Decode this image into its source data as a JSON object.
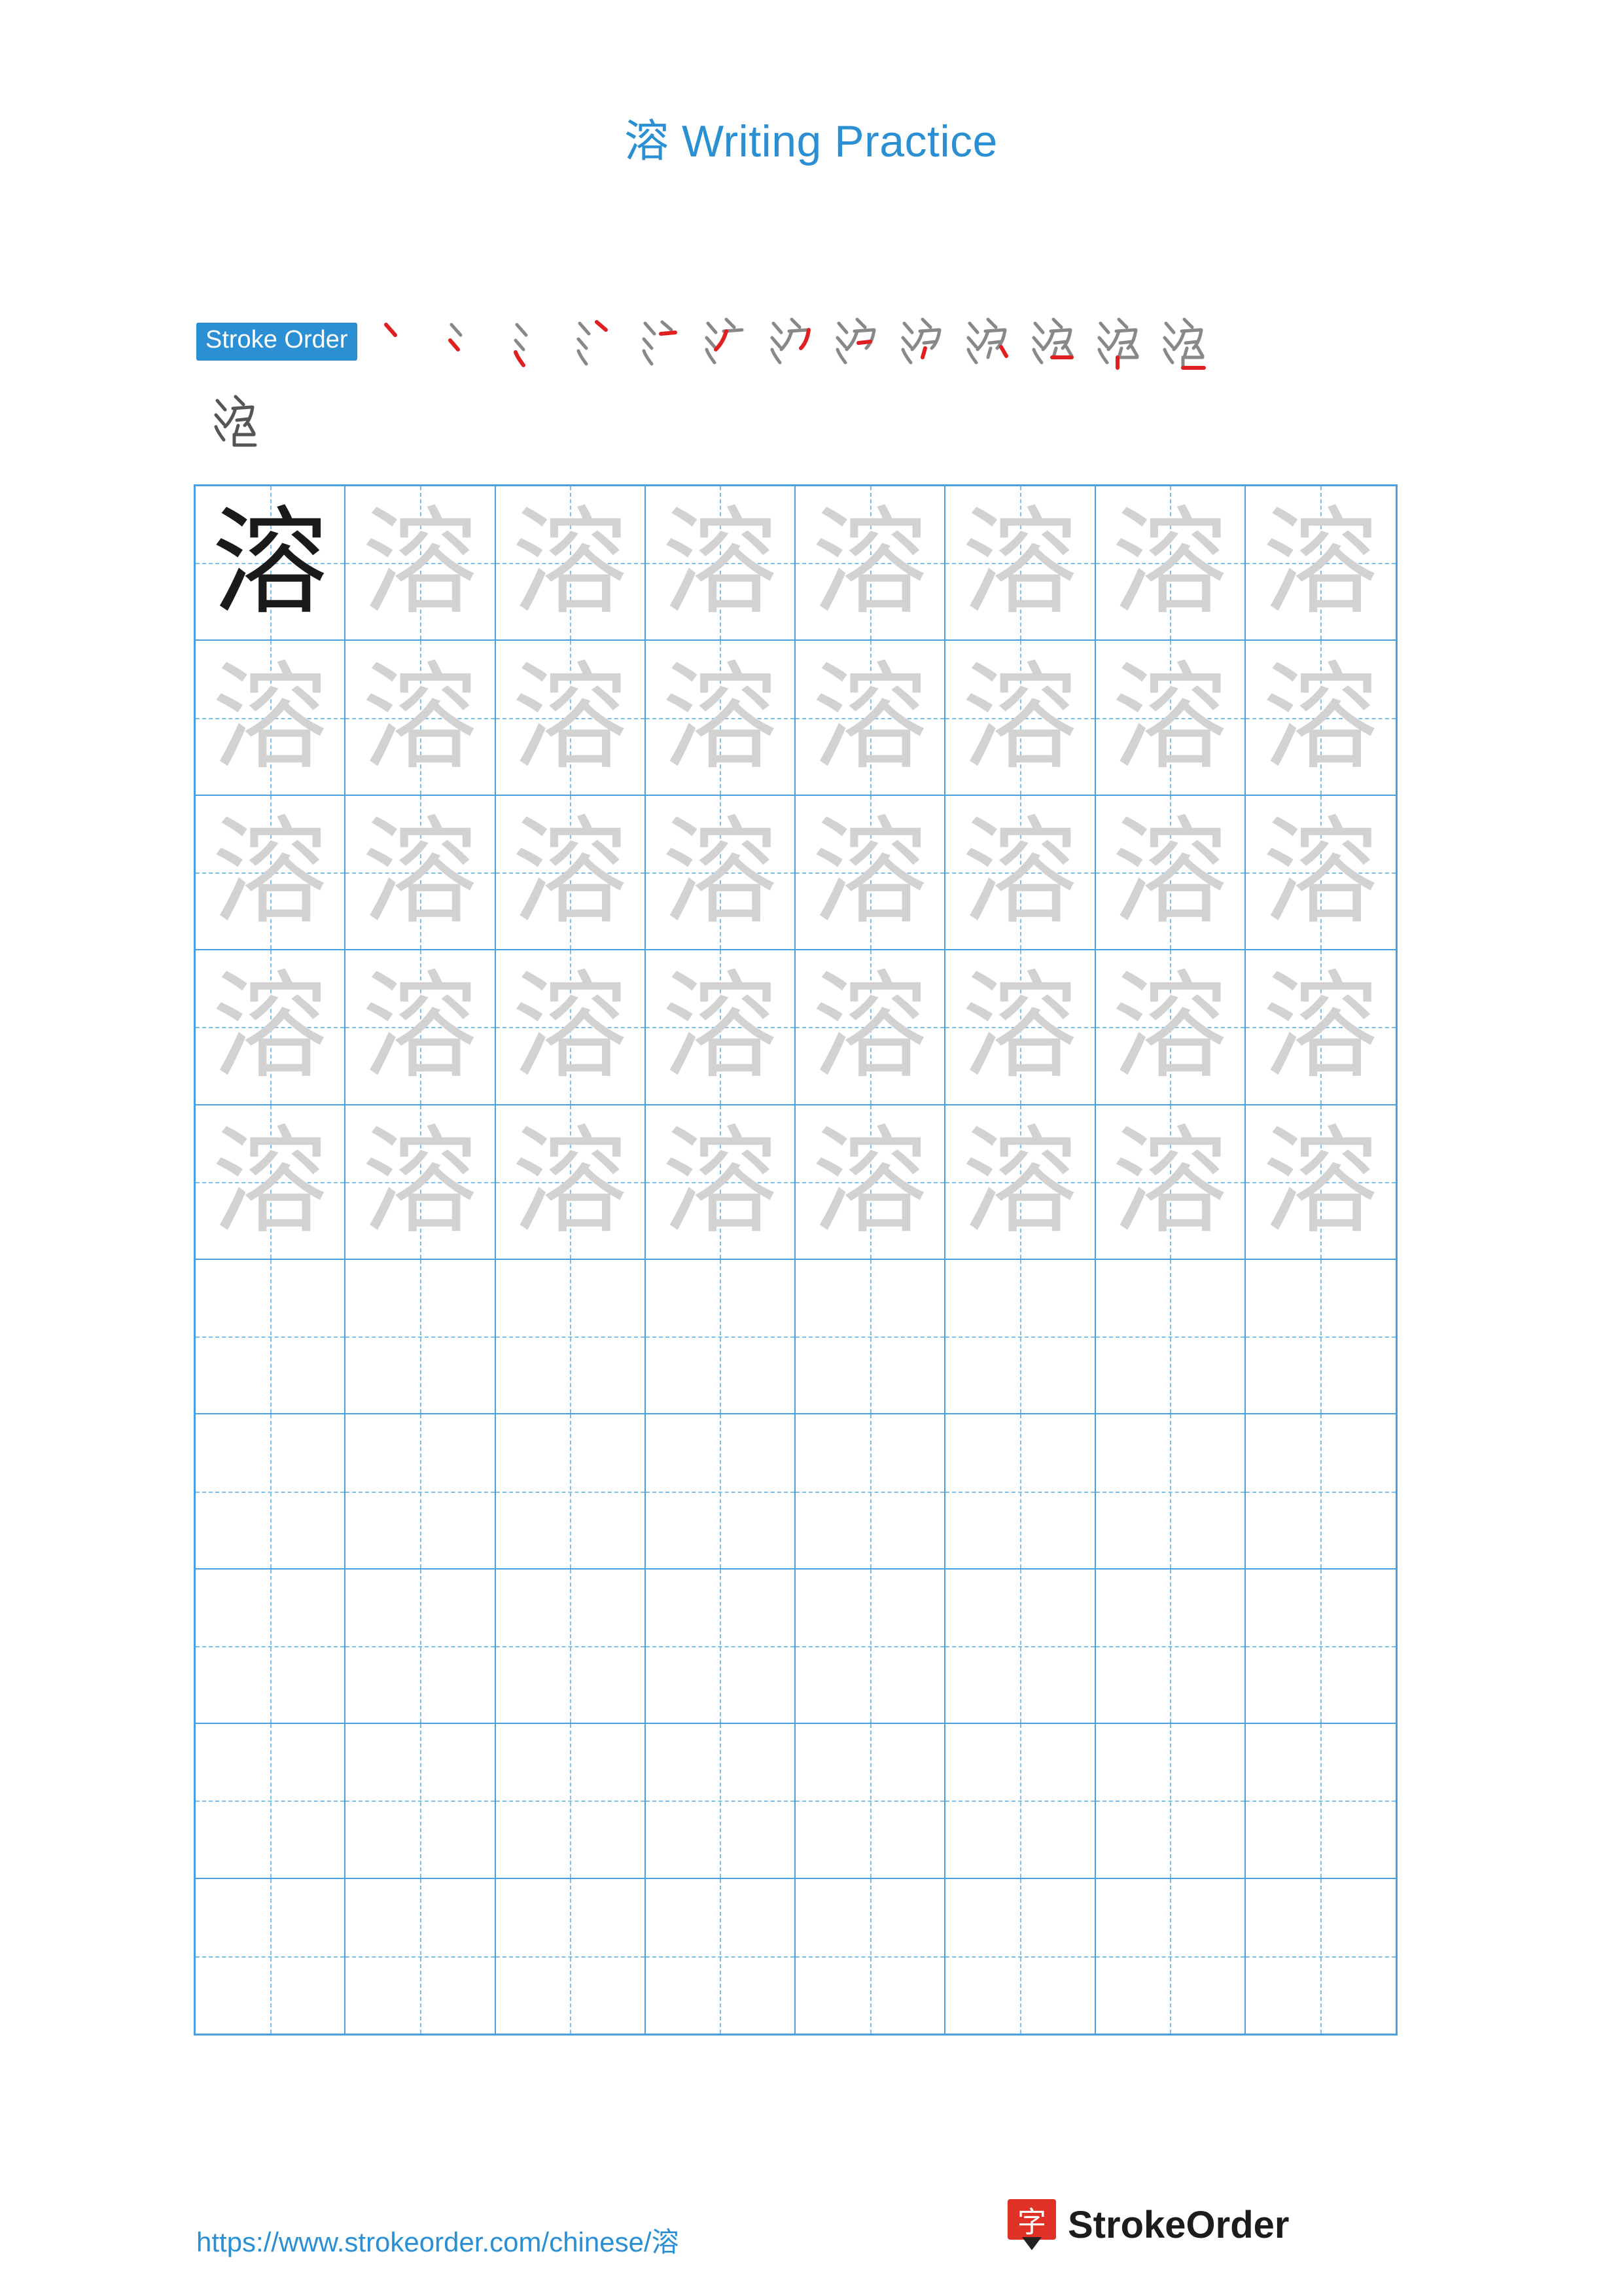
{
  "document": {
    "title": "溶 Writing Practice",
    "character": "溶"
  },
  "stroke_order": {
    "badge_label": "Stroke Order",
    "total_strokes": 13,
    "steps": [
      {
        "index": 1,
        "partial": "丶"
      },
      {
        "index": 2,
        "partial": "冫"
      },
      {
        "index": 3,
        "partial": "氵"
      },
      {
        "index": 4,
        "partial": "氵"
      },
      {
        "index": 5,
        "partial": "氵"
      },
      {
        "index": 6,
        "partial": "沪"
      },
      {
        "index": 7,
        "partial": "沪"
      },
      {
        "index": 8,
        "partial": "沪"
      },
      {
        "index": 9,
        "partial": "浐"
      },
      {
        "index": 10,
        "partial": "淡"
      },
      {
        "index": 11,
        "partial": "溶"
      },
      {
        "index": 12,
        "partial": "溶"
      },
      {
        "index": 13,
        "partial": "溶"
      }
    ]
  },
  "practice_grid": {
    "columns": 8,
    "rows": 10,
    "filled_rows": 5,
    "empty_rows": 5,
    "solid_cell_index": 0,
    "cell_character": "溶"
  },
  "footer": {
    "url": "https://www.strokeorder.com/chinese/溶",
    "brand_name": "StrokeOrder",
    "brand_logo_char": "字"
  },
  "colors": {
    "accent": "#2b8fd4",
    "grid_line": "#4a9fe0",
    "guide_line": "#7fc0ea",
    "ghost_glyph": "#d2d2d2",
    "solid_glyph": "#1a1a1a",
    "new_stroke": "#e02020",
    "logo_red": "#e03127"
  }
}
